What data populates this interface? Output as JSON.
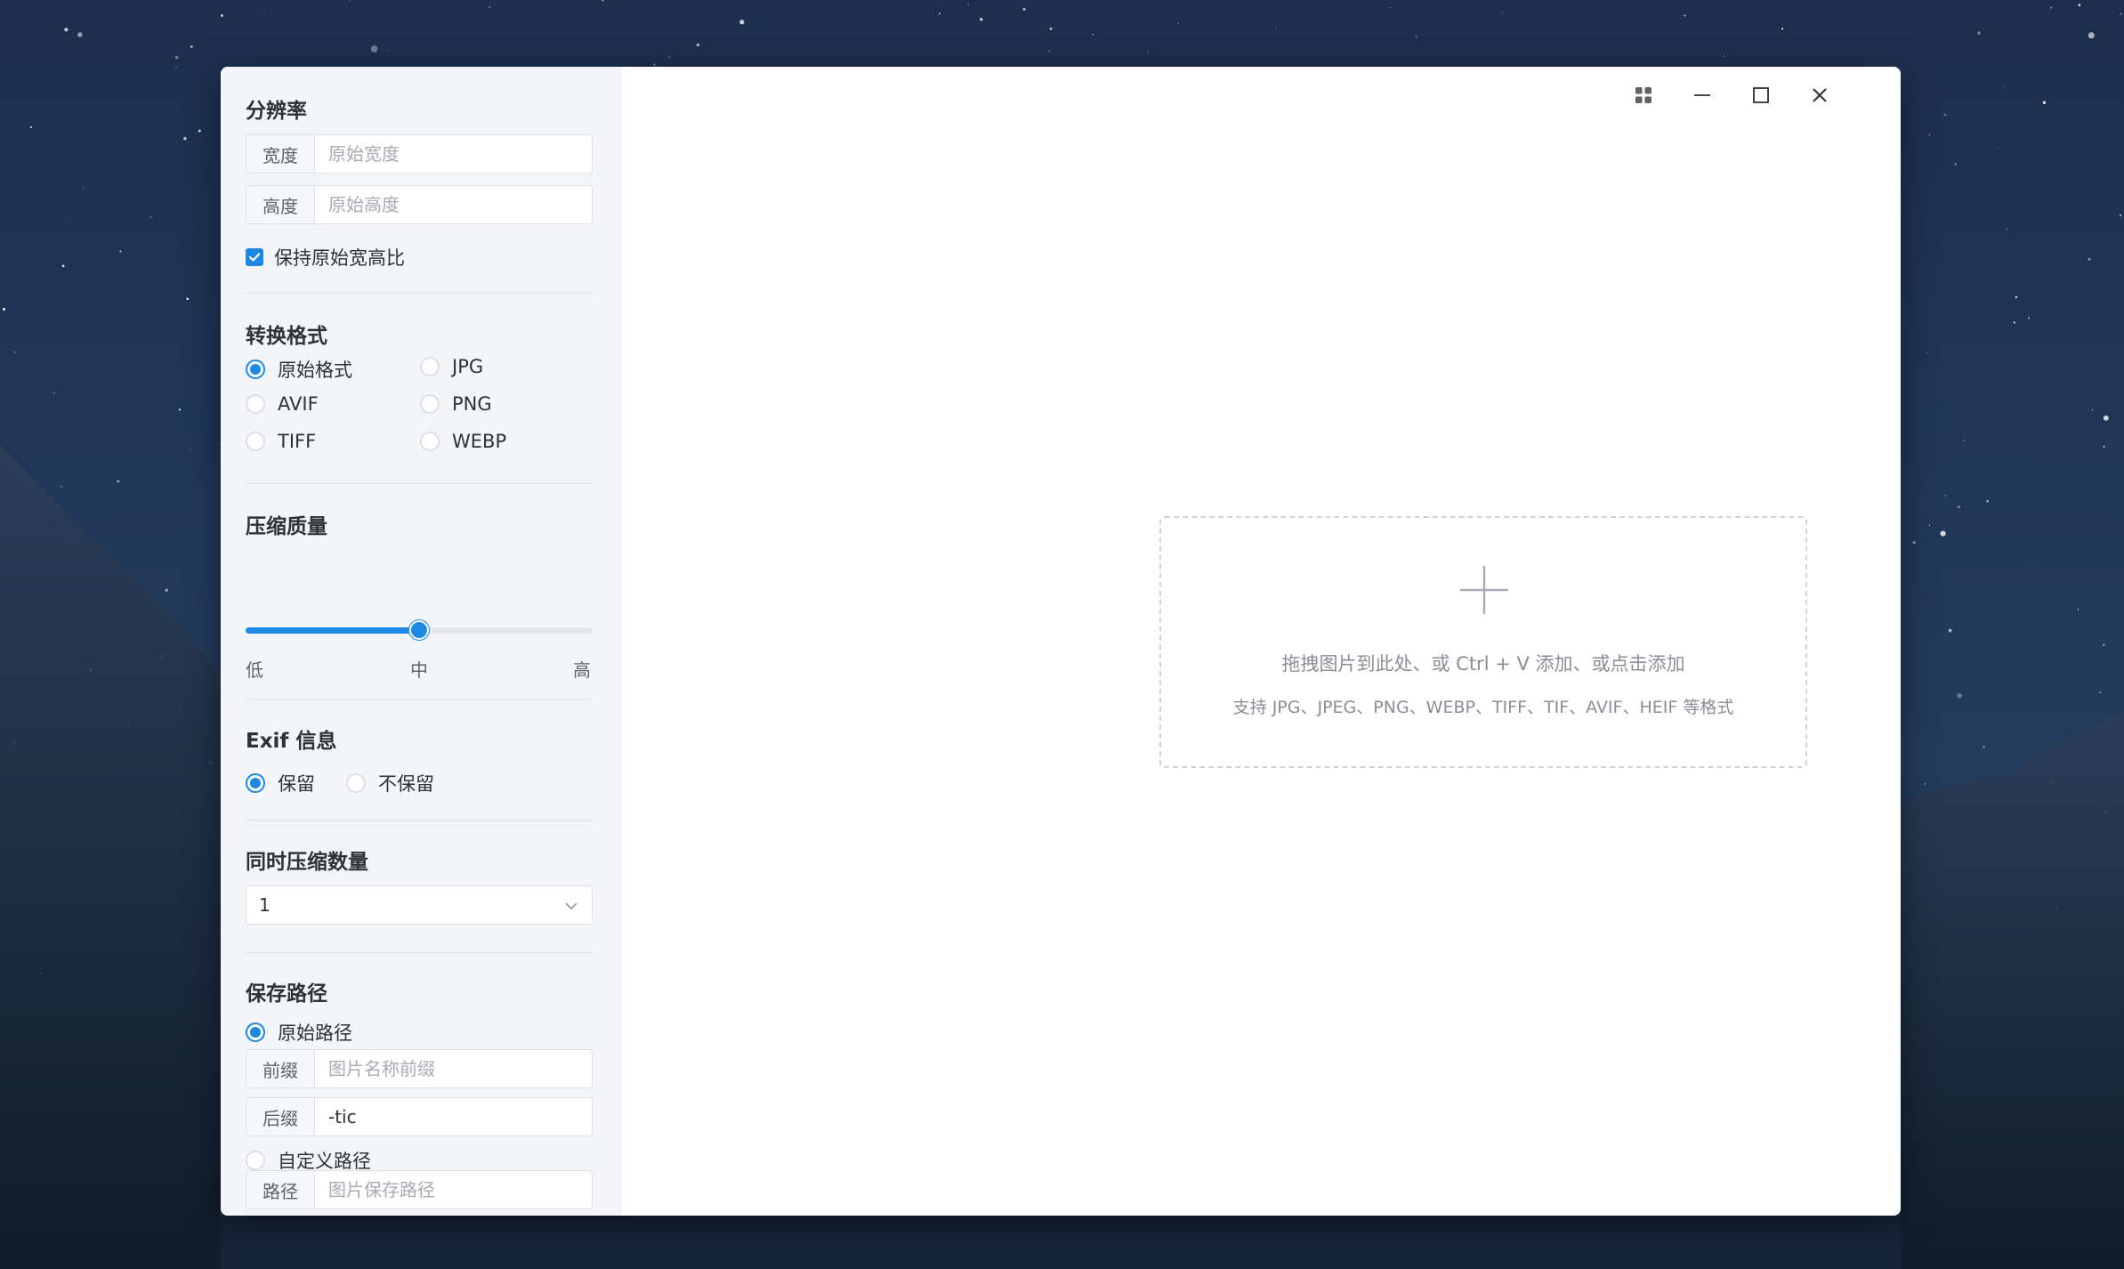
{
  "settings": {
    "resolution": {
      "title": "分辨率",
      "width_label": "宽度",
      "width_placeholder": "原始宽度",
      "width_value": "",
      "height_label": "高度",
      "height_placeholder": "原始高度",
      "height_value": "",
      "keep_ratio_label": "保持原始宽高比",
      "keep_ratio_checked": true
    },
    "format": {
      "title": "转换格式",
      "options": [
        "原始格式",
        "JPG",
        "AVIF",
        "PNG",
        "TIFF",
        "WEBP"
      ],
      "selected": "原始格式"
    },
    "quality": {
      "title": "压缩质量",
      "low_label": "低",
      "mid_label": "中",
      "high_label": "高",
      "level_fraction": 0.5
    },
    "exif": {
      "title": "Exif 信息",
      "options": [
        "保留",
        "不保留"
      ],
      "selected": "保留"
    },
    "concurrency": {
      "title": "同时压缩数量",
      "value": "1"
    },
    "save_path": {
      "title": "保存路径",
      "original_path_label": "原始路径",
      "prefix_label": "前缀",
      "prefix_placeholder": "图片名称前缀",
      "prefix_value": "",
      "suffix_label": "后缀",
      "suffix_value": "-tic",
      "custom_path_label": "自定义路径",
      "path_label": "路径",
      "path_placeholder": "图片保存路径",
      "path_value": "",
      "selected": "原始路径"
    }
  },
  "window_controls": [
    "grid-icon",
    "minimize-icon",
    "maximize-icon",
    "close-icon"
  ],
  "dropzone": {
    "hint": "拖拽图片到此处、或 Ctrl + V 添加、或点击添加",
    "supported": "支持 JPG、JPEG、PNG、WEBP、TIFF、TIF、AVIF、HEIF 等格式"
  },
  "colors": {
    "accent": "#1e88e5",
    "sidebar_bg": "#f3f5f9",
    "border": "#dcdfe6"
  }
}
